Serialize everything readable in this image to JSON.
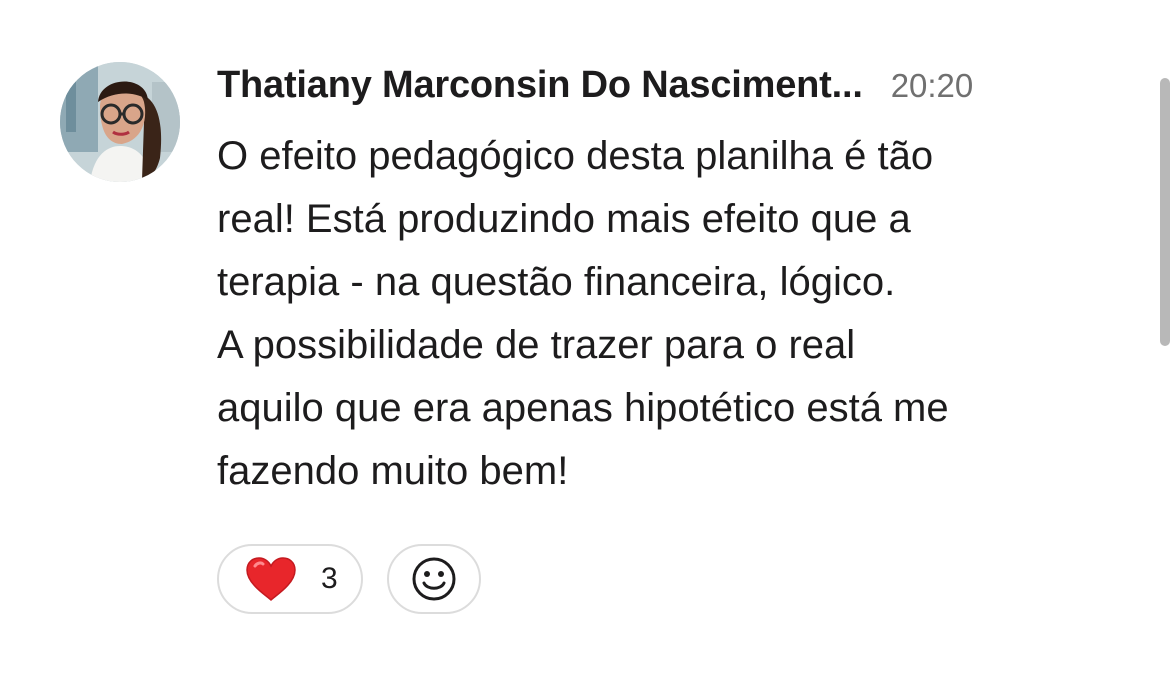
{
  "message": {
    "author": "Thatiany Marconsin Do Nasciment...",
    "time": "20:20",
    "body_lines": [
      "O efeito pedagógico desta planilha é tão",
      "real! Está produzindo mais efeito que a",
      "terapia - na questão financeira, lógico.",
      "A possibilidade de trazer para o real",
      "aquilo que era apenas hipotético está me",
      "fazendo muito bem!"
    ],
    "reactions": [
      {
        "icon": "red-heart-icon",
        "count": "3"
      }
    ],
    "add_reaction_icon": "smiley-face-icon"
  },
  "colors": {
    "text": "#1d1c1d",
    "timestamp": "#707070",
    "pill_border": "#dcdcdc",
    "heart": "#e8262b",
    "scrollbar": "#b8b8b8"
  }
}
